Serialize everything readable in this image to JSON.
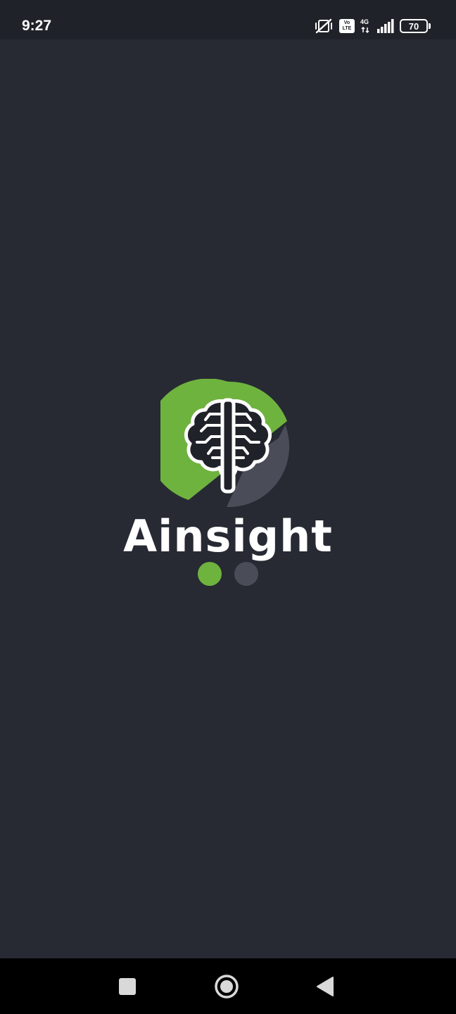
{
  "status_bar": {
    "time": "9:27",
    "volte_top": "Vo",
    "volte_bottom": "LTE",
    "network_type": "4G",
    "battery_level": "70",
    "icons": [
      "vibrate-mute-icon",
      "volte-icon",
      "signal-icon",
      "battery-icon"
    ]
  },
  "splash": {
    "app_name": "Ainsight",
    "logo_icon": "brain-icon",
    "colors": {
      "background": "#272a33",
      "accent_green": "#6fb33f",
      "accent_grey": "#4a4d58",
      "text": "#ffffff"
    },
    "loader": {
      "total_dots": 2,
      "active_index": 0
    }
  },
  "nav_bar": {
    "buttons": [
      "recents-button",
      "home-button",
      "back-button"
    ]
  }
}
